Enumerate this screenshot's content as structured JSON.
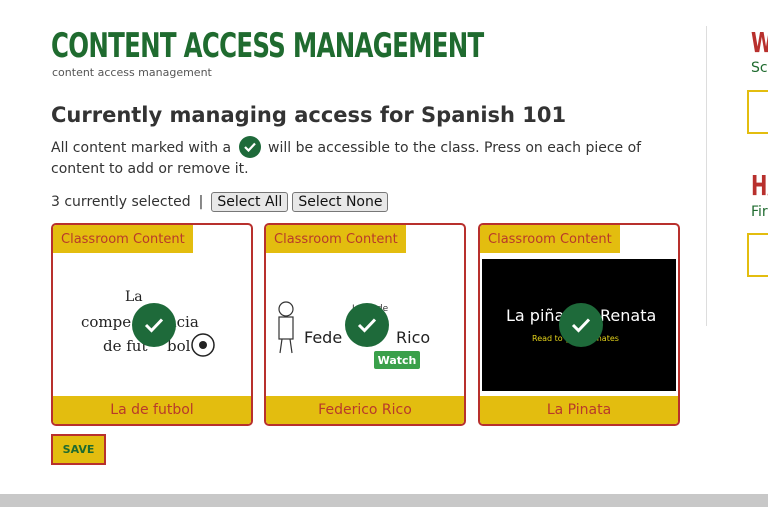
{
  "page": {
    "title": "CONTENT ACCESS MANAGEMENT",
    "subtitle": "content access management",
    "heading": "Currently managing access for Spanish 101",
    "desc_before": "All content marked with a",
    "desc_after": "will be accessible to the class. Press on each piece of content to add or remove it.",
    "selected_count_text": "3 currently selected",
    "separator": "|",
    "select_all_label": "Select All",
    "select_none_label": "Select None",
    "save_label": "SAVE"
  },
  "cards": [
    {
      "tag": "Classroom Content",
      "title": "La de futbol",
      "thumb_text": "La competencia de futbol",
      "selected": true
    },
    {
      "tag": "Classroom Content",
      "title": "Federico Rico",
      "thumb_text": "La familia de Federico Rico",
      "thumb_badge": "Watch",
      "selected": true
    },
    {
      "tag": "Classroom Content",
      "title": "La Pinata",
      "thumb_text": "La piñata de Renata",
      "thumb_subtext": "Read to get animates",
      "selected": true
    }
  ],
  "sidebar": {
    "section1_heading": "W",
    "section1_text": "Sch",
    "section2_heading": "HA",
    "section2_text": "Fir"
  },
  "colors": {
    "brand_green": "#1f6b2f",
    "brand_red": "#b8302d",
    "brand_yellow": "#e3bd0f",
    "check_green": "#1e6a3a"
  },
  "icons": {
    "check": "check-icon"
  }
}
